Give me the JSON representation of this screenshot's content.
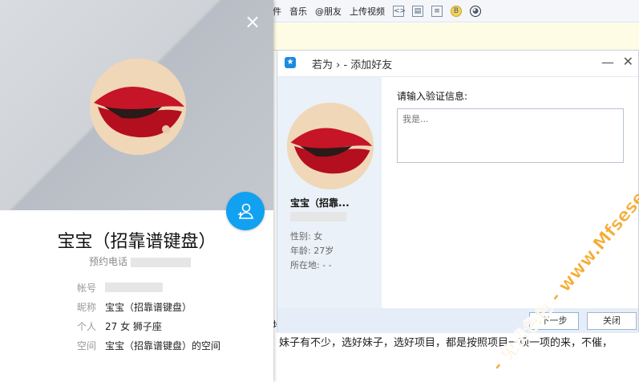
{
  "toolbar": {
    "items": [
      "件",
      "音乐",
      "@朋友",
      "上传视频"
    ],
    "icons": [
      "code-icon",
      "page-icon",
      "list-icon",
      "bg-icon",
      "qq-penguin-icon"
    ]
  },
  "background": {
    "bottom_text": "妹子有不少，选好妹子，选好项目，都是按照项目一项一项的来，不催，",
    "side_char": "地"
  },
  "profile": {
    "name": "宝宝（招靠谱键盘）",
    "phone_label": "预约电话",
    "rows": [
      {
        "label": "帐号",
        "value": ""
      },
      {
        "label": "昵称",
        "value": "宝宝（招靠谱键盘）"
      },
      {
        "label": "个人",
        "value": "27 女 狮子座"
      },
      {
        "label": "空间",
        "value": "宝宝（招靠谱键盘）的空间"
      }
    ]
  },
  "dialog": {
    "title": "若为 › - 添加好友",
    "name": "宝宝（招靠...",
    "gender": "性别: 女",
    "age": "年龄: 27岁",
    "location": "所在地:  -    -",
    "verify_label": "请输入验证信息:",
    "verify_placeholder": "我是...",
    "next_label": "下一步",
    "close_label": "关闭"
  },
  "watermark": "- 免费色色 - www.Mfsese.com",
  "colors": {
    "accent": "#12a1f0",
    "watermark": "#f5a623"
  }
}
